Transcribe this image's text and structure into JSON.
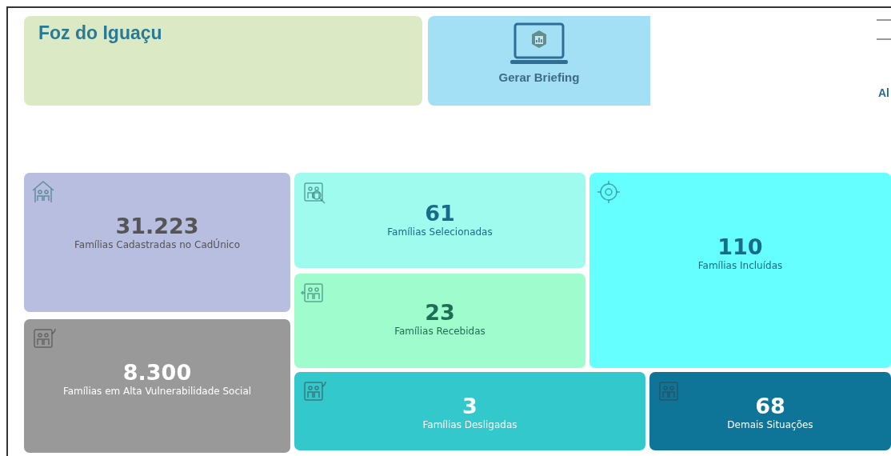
{
  "header": {
    "title": "Foz do Iguaçu",
    "briefing_button": "Gerar Briefing",
    "side_text": "Al"
  },
  "tiles": [
    {
      "value": "31.223",
      "label": "Famílias Cadastradas no CadÚnico",
      "color": "#b7bedf"
    },
    {
      "value": "8.300",
      "label": "Famílias em Alta Vulnerabilidade Social",
      "color": "#999999"
    },
    {
      "value": "61",
      "label": "Famílias Selecionadas",
      "color": "#9ffbee"
    },
    {
      "value": "23",
      "label": "Famílias Recebidas",
      "color": "#9ffccc"
    },
    {
      "value": "110",
      "label": "Famílias Incluídas",
      "color": "#66ffff"
    },
    {
      "value": "3",
      "label": "Famílias Desligadas",
      "color": "#33c9cc"
    },
    {
      "value": "68",
      "label": "Demais Situações",
      "color": "#0e7599"
    }
  ]
}
